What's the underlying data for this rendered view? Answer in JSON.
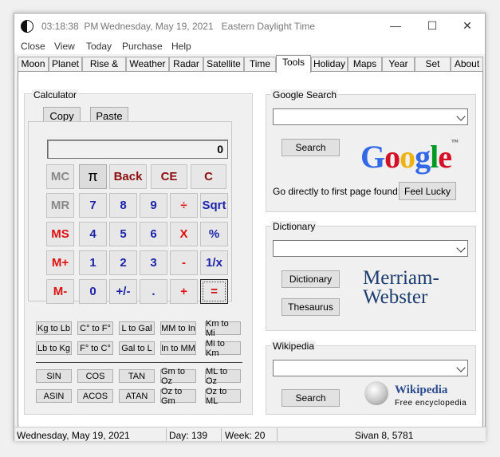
{
  "window": {
    "time": "03:18:38  PM",
    "date_title": "Wednesday, May 19, 2021   Eastern Daylight Time",
    "minimize_glyph": "—",
    "maximize_glyph": "☐",
    "close_glyph": "✕"
  },
  "menu": [
    "Close",
    "View",
    "Today",
    "Purchase",
    "Help"
  ],
  "tabs": [
    "Moon",
    "Planet",
    "Rise & Set",
    "Weather",
    "Radar",
    "Satellite",
    "Time",
    "Tools",
    "Holiday",
    "Maps",
    "Year",
    "Set",
    "About"
  ],
  "active_tab": "Tools",
  "calculator": {
    "group_label": "Calculator",
    "copy_label": "Copy",
    "paste_label": "Paste",
    "display_value": "0",
    "keys": {
      "mc": "MC",
      "pi": "π",
      "back": "Back",
      "ce": "CE",
      "c": "C",
      "mr": "MR",
      "k7": "7",
      "k8": "8",
      "k9": "9",
      "div": "÷",
      "sqrt": "Sqrt",
      "ms": "MS",
      "k4": "4",
      "k5": "5",
      "k6": "6",
      "mul": "X",
      "pct": "%",
      "mplus": "M+",
      "k1": "1",
      "k2": "2",
      "k3": "3",
      "minus": "-",
      "inv": "1/x",
      "mminus": "M-",
      "k0": "0",
      "sign": "+/-",
      "dot": ".",
      "plus": "+",
      "eq": "="
    },
    "conversions": [
      [
        "Kg to Lb",
        "C° to F°",
        "L to Gal",
        "MM to In",
        "Km to Mi"
      ],
      [
        "Lb to Kg",
        "F° to C°",
        "Gal to L",
        "In to MM",
        "Mi to Km"
      ]
    ],
    "trig": [
      [
        "SIN",
        "COS",
        "TAN",
        "Gm to Oz",
        "ML to Oz"
      ],
      [
        "ASIN",
        "ACOS",
        "ATAN",
        "Oz to Gm",
        "Oz to ML"
      ]
    ]
  },
  "google": {
    "group_label": "Google Search",
    "search_value": "",
    "search_button": "Search",
    "logo_letters": [
      "G",
      "o",
      "o",
      "g",
      "l",
      "e"
    ],
    "logo_colors": [
      "#3369e8",
      "#d50f25",
      "#eeb211",
      "#3369e8",
      "#009925",
      "#d50f25"
    ],
    "logo_tm": "™",
    "direct_label": "Go directly to first page found:",
    "lucky_button": "Feel Lucky"
  },
  "dictionary": {
    "group_label": "Dictionary",
    "search_value": "",
    "dictionary_button": "Dictionary",
    "thesaurus_button": "Thesaurus",
    "logo_line1": "Merriam-",
    "logo_line2": "Webster"
  },
  "wikipedia": {
    "group_label": "Wikipedia",
    "search_value": "",
    "search_button": "Search",
    "logo_title": "Wikipedia",
    "logo_subtitle": "Free encyclopedia"
  },
  "status": {
    "date": "Wednesday, May 19, 2021",
    "day": "Day: 139",
    "week": "Week: 20",
    "hebrew_date": "Sivan 8, 5781"
  }
}
